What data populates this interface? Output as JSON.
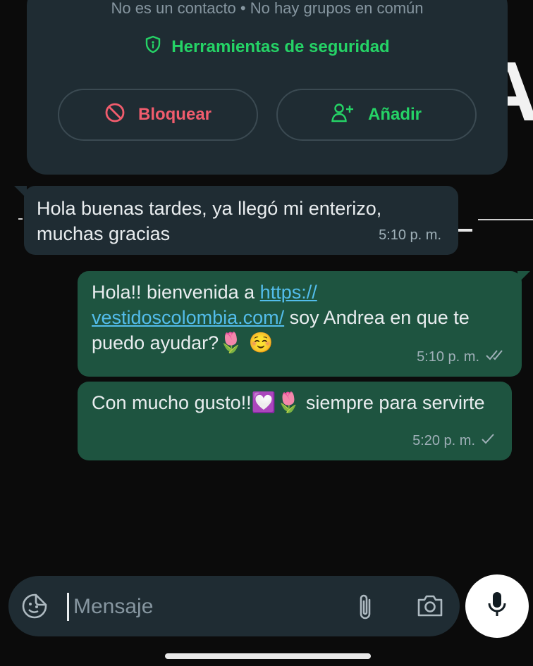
{
  "contact_info": {
    "status_text": "No es un contacto • No hay grupos en común",
    "security_label": "Herramientas de seguridad",
    "block_label": "Bloquear",
    "add_label": "Añadir"
  },
  "messages": [
    {
      "direction": "incoming",
      "text": "Hola buenas tardes, ya llegó mi enterizo, muchas gracias",
      "time": "5:10 p. m."
    },
    {
      "direction": "outgoing",
      "text_before_link": "Hola!!  bienvenida a ",
      "link": "https://vestidoscolombia.com/",
      "link_line1": "https://",
      "link_line2": "vestidoscolombia.com/",
      "text_after_link": " soy Andrea en que te puedo ayudar?",
      "emoji1": "🌷",
      "emoji2": "☺️",
      "time": "5:10 p. m.",
      "status": "read"
    },
    {
      "direction": "outgoing",
      "text": "Con mucho gusto!!",
      "emoji1": "💟",
      "emoji2": "🌷",
      "text_after": " siempre para servirte",
      "time": "5:20 p. m.",
      "status": "sent"
    }
  ],
  "composer": {
    "placeholder": "Mensaje",
    "value": ""
  },
  "colors": {
    "accent_green": "#25d366",
    "danger_red": "#f15c6d",
    "outgoing_bubble": "#1e5440",
    "incoming_bubble": "#1f2c33",
    "link_blue": "#53bdeb"
  }
}
